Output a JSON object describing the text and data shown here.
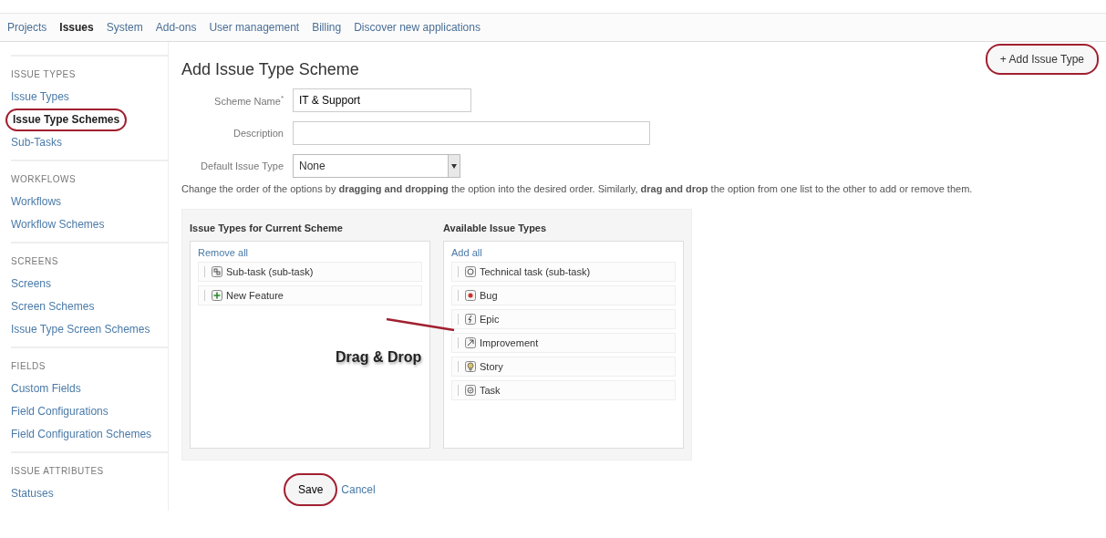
{
  "nav": [
    {
      "label": "Projects",
      "selected": false
    },
    {
      "label": "Issues",
      "selected": true
    },
    {
      "label": "System",
      "selected": false
    },
    {
      "label": "Add-ons",
      "selected": false
    },
    {
      "label": "User management",
      "selected": false
    },
    {
      "label": "Billing",
      "selected": false
    },
    {
      "label": "Discover new applications",
      "selected": false
    }
  ],
  "sidebar": [
    {
      "heading": "ISSUE TYPES",
      "items": [
        {
          "label": "Issue Types",
          "selected": false,
          "highlighted": false
        },
        {
          "label": "Issue Type Schemes",
          "selected": true,
          "highlighted": true
        },
        {
          "label": "Sub-Tasks",
          "selected": false,
          "highlighted": false
        }
      ]
    },
    {
      "heading": "WORKFLOWS",
      "items": [
        {
          "label": "Workflows",
          "selected": false,
          "highlighted": false
        },
        {
          "label": "Workflow Schemes",
          "selected": false,
          "highlighted": false
        }
      ]
    },
    {
      "heading": "SCREENS",
      "items": [
        {
          "label": "Screens",
          "selected": false,
          "highlighted": false
        },
        {
          "label": "Screen Schemes",
          "selected": false,
          "highlighted": false
        },
        {
          "label": "Issue Type Screen Schemes",
          "selected": false,
          "highlighted": false
        }
      ]
    },
    {
      "heading": "FIELDS",
      "items": [
        {
          "label": "Custom Fields",
          "selected": false,
          "highlighted": false
        },
        {
          "label": "Field Configurations",
          "selected": false,
          "highlighted": false
        },
        {
          "label": "Field Configuration Schemes",
          "selected": false,
          "highlighted": false
        }
      ]
    },
    {
      "heading": "ISSUE ATTRIBUTES",
      "items": [
        {
          "label": "Statuses",
          "selected": false,
          "highlighted": false
        }
      ]
    }
  ],
  "page_title": "Add Issue Type Scheme",
  "add_button": {
    "label": "+ Add Issue Type",
    "highlighted": true
  },
  "form": {
    "scheme_name": {
      "label": "Scheme Name",
      "required_mark": "*",
      "value": "IT & Support"
    },
    "description": {
      "label": "Description"
    },
    "default_type": {
      "label": "Default Issue Type",
      "value": "None"
    }
  },
  "instructions": "Change the order of the options by **dragging and dropping** the option into the desired order. Similarly, **drag and drop** the option from one list to the other to add or remove them.",
  "lists": [
    {
      "title": "Issue Types for Current Scheme",
      "action": "Remove all",
      "items": [
        {
          "label": "Sub-task (sub-task)",
          "kind": "subtask"
        },
        {
          "label": "New Feature",
          "kind": "feature"
        }
      ]
    },
    {
      "title": "Available Issue Types",
      "action": "Add all",
      "items": [
        {
          "label": "Technical task (sub-task)",
          "kind": "technical"
        },
        {
          "label": "Bug",
          "kind": "bug"
        },
        {
          "label": "Epic",
          "kind": "epic"
        },
        {
          "label": "Improvement",
          "kind": "improvement"
        },
        {
          "label": "Story",
          "kind": "story"
        },
        {
          "label": "Task",
          "kind": "task"
        }
      ]
    }
  ],
  "annotation": {
    "label": "Drag & Drop"
  },
  "save_button": {
    "label": "Save",
    "highlighted": true
  },
  "cancel_link": "Cancel"
}
